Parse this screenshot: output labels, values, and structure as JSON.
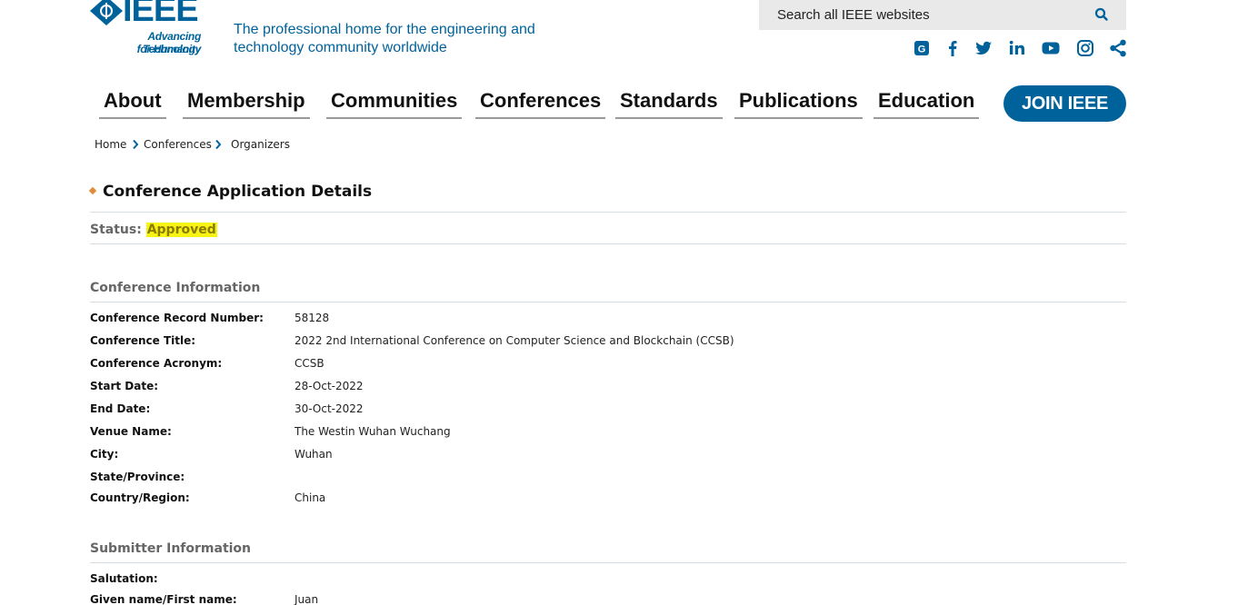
{
  "logo": {
    "wordmark": "IEEE",
    "tagline_line1": "Advancing Technology",
    "tagline_line2": "for Humanity"
  },
  "header": {
    "tagline_line1": "The professional home for the engineering and",
    "tagline_line2": "technology community worldwide"
  },
  "search": {
    "placeholder": "Search all IEEE websites",
    "icon": "search-icon"
  },
  "social": [
    {
      "name": "ieee-collabratec-icon"
    },
    {
      "name": "facebook-icon"
    },
    {
      "name": "twitter-icon"
    },
    {
      "name": "linkedin-icon"
    },
    {
      "name": "youtube-icon"
    },
    {
      "name": "instagram-icon"
    },
    {
      "name": "share-icon"
    }
  ],
  "nav": {
    "items": [
      "About",
      "Membership",
      "Communities",
      "Conferences",
      "Standards",
      "Publications",
      "Education"
    ],
    "join_label": "JOIN IEEE"
  },
  "breadcrumb": [
    "Home",
    "Conferences",
    "Organizers"
  ],
  "page": {
    "title": "Conference Application Details",
    "status_label": "Status:",
    "status_value": "Approved"
  },
  "conference_info": {
    "title": "Conference Information",
    "rows": [
      {
        "label": "Conference Record Number:",
        "value": "58128"
      },
      {
        "label": "Conference Title:",
        "value": "2022 2nd International Conference on Computer Science and Blockchain (CCSB)"
      },
      {
        "label": "Conference Acronym:",
        "value": "CCSB"
      },
      {
        "label": "Start Date:",
        "value": "28-Oct-2022"
      },
      {
        "label": "End Date:",
        "value": "30-Oct-2022"
      },
      {
        "label": "Venue Name:",
        "value": "The Westin Wuhan Wuchang"
      },
      {
        "label": "City:",
        "value": "Wuhan"
      },
      {
        "label": "State/Province:",
        "value": ""
      },
      {
        "label": "Country/Region:",
        "value": "China"
      }
    ]
  },
  "submitter_info": {
    "title": "Submitter Information",
    "rows": [
      {
        "label": "Salutation:",
        "value": ""
      },
      {
        "label": "Given name/First name:",
        "value": "Juan"
      }
    ]
  },
  "colors": {
    "brand": "#00629b",
    "status_highlight": "#f7f313",
    "bullet": "#e08d3c"
  }
}
